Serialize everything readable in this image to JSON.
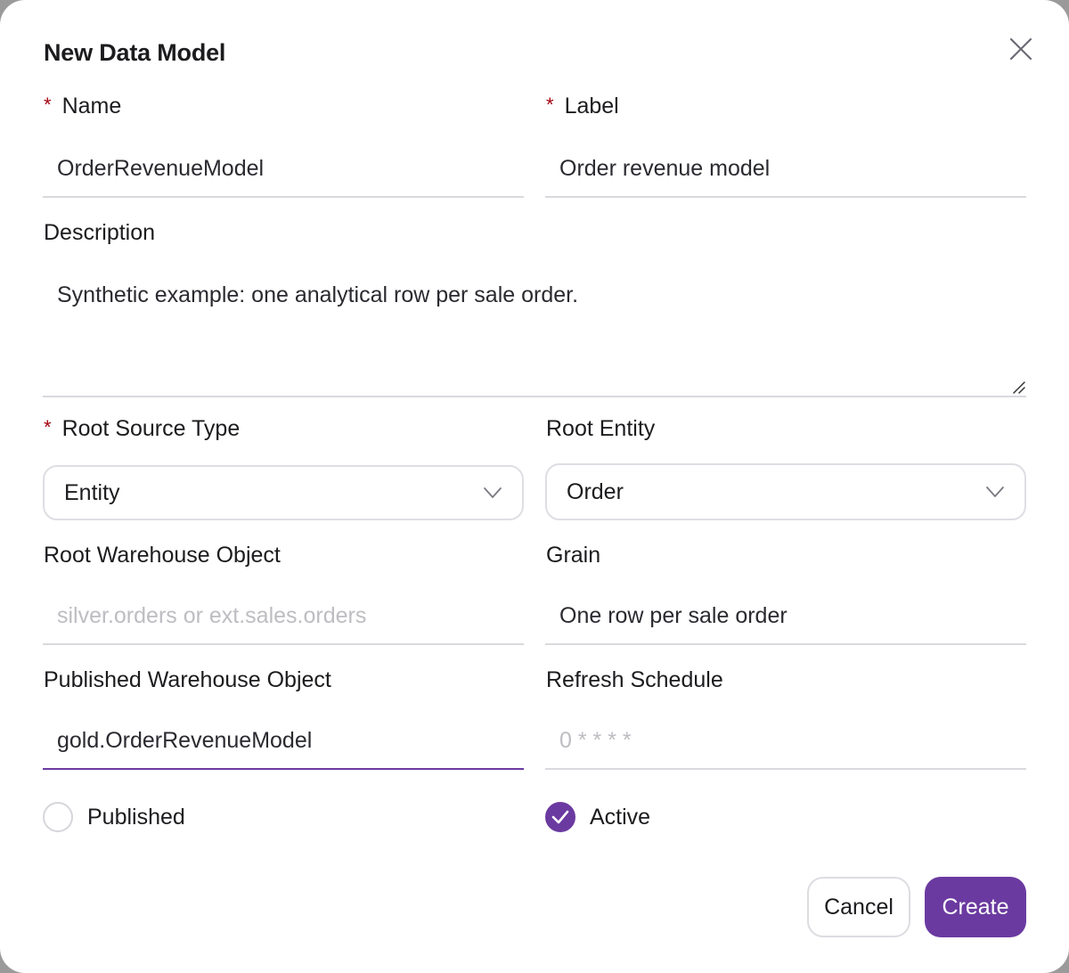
{
  "dialog": {
    "title": "New Data Model",
    "close_icon": "close-icon"
  },
  "fields": {
    "name": {
      "label": "Name",
      "required_mark": "*",
      "value": "OrderRevenueModel"
    },
    "label": {
      "label": "Label",
      "required_mark": "*",
      "value": "Order revenue model"
    },
    "description": {
      "label": "Description",
      "value": "Synthetic example: one analytical row per sale order."
    },
    "root_source_type": {
      "label": "Root Source Type",
      "required_mark": "*",
      "value": "Entity"
    },
    "root_entity": {
      "label": "Root Entity",
      "value": "Order"
    },
    "root_warehouse_object": {
      "label": "Root Warehouse Object",
      "value": "",
      "placeholder": "silver.orders or ext.sales.orders"
    },
    "grain": {
      "label": "Grain",
      "value": "One row per sale order"
    },
    "published_warehouse_object": {
      "label": "Published Warehouse Object",
      "value": "gold.OrderRevenueModel"
    },
    "refresh_schedule": {
      "label": "Refresh Schedule",
      "value": "",
      "placeholder": "0 * * * *"
    }
  },
  "checkboxes": {
    "published": {
      "label": "Published",
      "checked": false
    },
    "active": {
      "label": "Active",
      "checked": true
    }
  },
  "actions": {
    "cancel_label": "Cancel",
    "create_label": "Create"
  },
  "colors": {
    "accent": "#6b3aa0",
    "required": "#a4000f",
    "border": "#d9d9de",
    "placeholder": "#bdbdc2"
  }
}
